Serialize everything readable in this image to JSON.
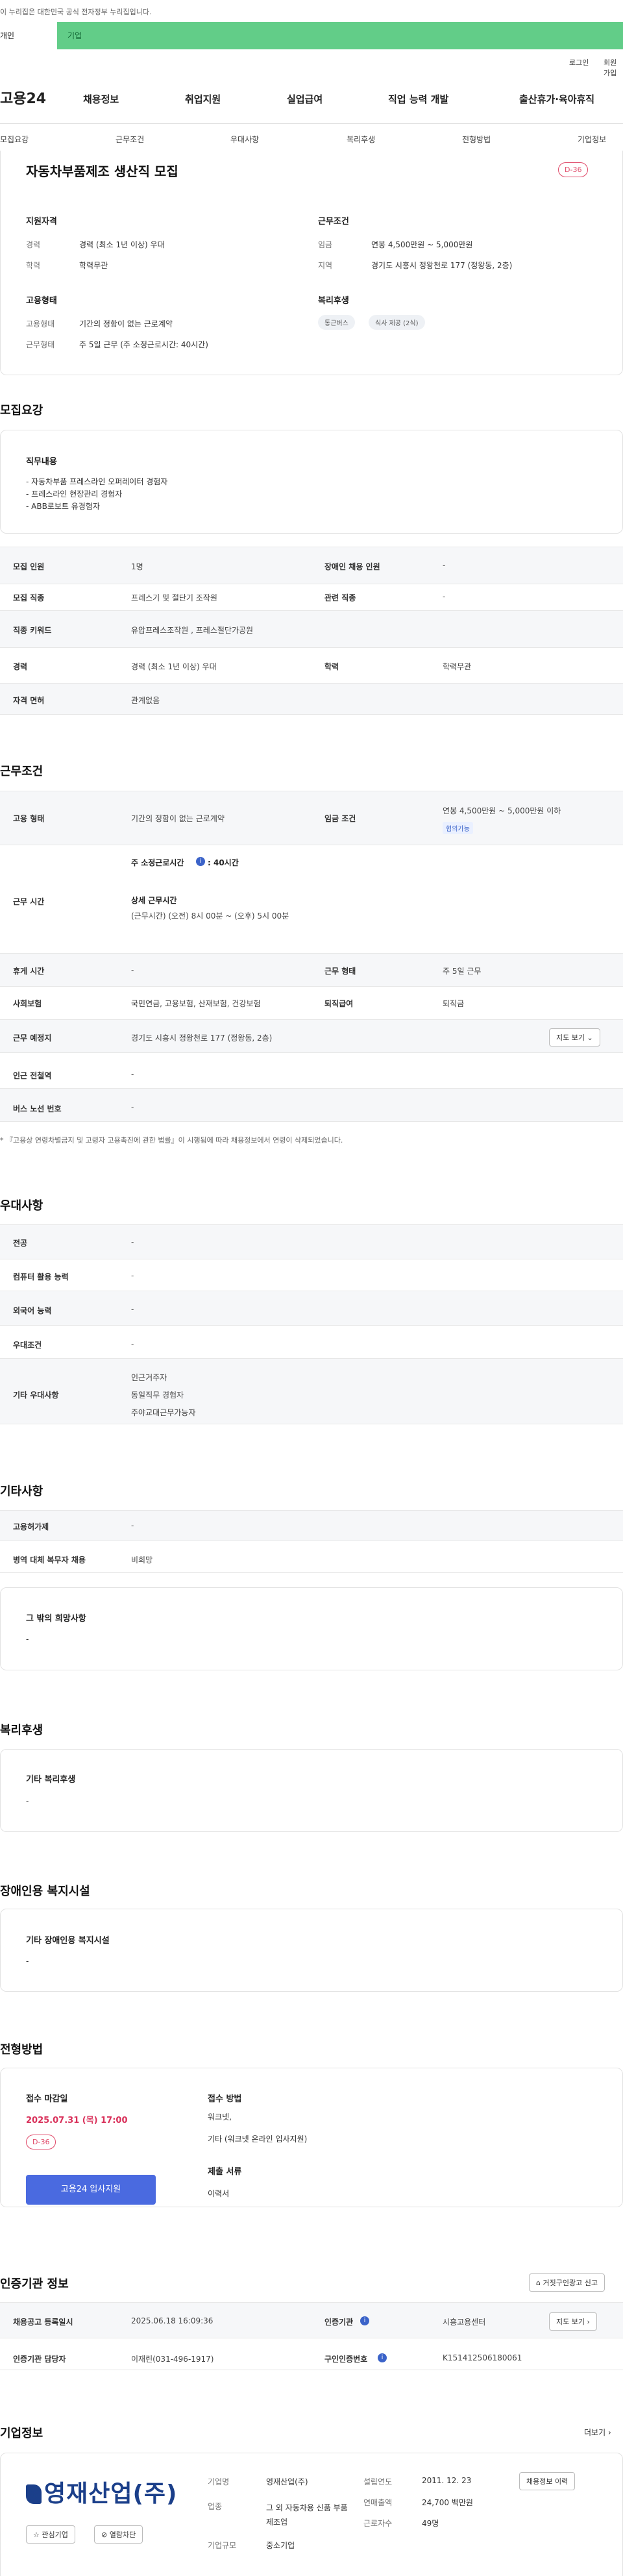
{
  "gov_banner": "이 누리집은 대한민국 공식 전자정부 누리집입니다.",
  "tabs": {
    "individual": "개인",
    "enterprise": "기업"
  },
  "top_links": [
    "로그인",
    "회원가입"
  ],
  "logo_text": "고용24",
  "gnb": [
    "채용정보",
    "취업지원",
    "실업급여",
    "직업 능력 개발",
    "출산휴가·육아휴직"
  ],
  "subnav": [
    "모집요강",
    "근무조건",
    "우대사항",
    "복리후생",
    "전형방법",
    "기업정보"
  ],
  "job": {
    "title": "자동차부품제조 생산직 모집",
    "dday": "D-36",
    "qual_heading": "지원자격",
    "career_label": "경력",
    "career_value": "경력 (최소 1년 이상) 우대",
    "edu_label": "학력",
    "edu_value": "학력무관",
    "emp_heading": "고용형태",
    "emp_label": "고용형태",
    "emp_value": "기간의 정함이 없는 근로계약",
    "work_label": "근무형태",
    "work_value": "주 5일 근무 (주 소정근로시간: 40시간)",
    "cond_heading": "근무조건",
    "wage_label": "임금",
    "wage_value": "연봉 4,500만원 ~ 5,000만원",
    "region_label": "지역",
    "region_value": "경기도 시흥시 정왕천로 177 (정왕동, 2층)",
    "welfare_heading": "복리후생",
    "chips": [
      "통근버스",
      "식사 제공 (2식)"
    ]
  },
  "recruit": {
    "heading": "모집요강",
    "duty_heading": "직무내용",
    "duties": [
      "- 자동차부품 프레스라인 오퍼레이터 경험자",
      "- 프레스라인 현장관리 경험자",
      "- ABB로보트 유경험자"
    ],
    "rows": [
      [
        "모집 인원",
        "1명",
        "장애인 채용 인원",
        "-"
      ],
      [
        "모집 직종",
        "프레스기 및 절단기 조작원",
        "관련 직종",
        "-"
      ],
      [
        "직종 키워드",
        "유압프레스조작원 , 프레스절단가공원",
        "",
        ""
      ],
      [
        "경력",
        "경력 (최소 1년 이상) 우대",
        "학력",
        "학력무관"
      ],
      [
        "자격 면허",
        "관계없음",
        "",
        ""
      ]
    ]
  },
  "conditions": {
    "heading": "근무조건",
    "emp_type_label": "고용 형태",
    "emp_type_value": "기간의 정함이 없는 근로계약",
    "wage_label": "임금 조건",
    "wage_value": "연봉 4,500만원 ~ 5,000만원 이하",
    "wage_chip": "협의가능",
    "hours_label": "근무 시간",
    "hours_weekly": "주 소정근로시간",
    "hours_weekly_value": ": 40시간",
    "hours_detail_title": "상세 근무시간",
    "hours_detail": "(근무시간) (오전) 8시 00분 ~ (오후) 5시 00분",
    "break_label": "휴게 시간",
    "break_value": "-",
    "worktype_label": "근무 형태",
    "worktype_value": "주 5일 근무",
    "insurance_label": "사회보험",
    "insurance_value": "국민연금, 고용보험, 산재보험, 건강보험",
    "retire_label": "퇴직급여",
    "retire_value": "퇴직금",
    "place_label": "근무 예정지",
    "place_value": "경기도 시흥시 정왕천로 177 (정왕동, 2층)",
    "map_button": "지도 보기",
    "subway_label": "인근 전철역",
    "subway_value": "-",
    "bus_label": "버스 노선 번호",
    "bus_value": "-",
    "note": "* 『고용상 연령차별금지 및 고령자 고용촉진에 관한 법률』이 시행됨에 따라 채용정보에서 연령이 삭제되었습니다."
  },
  "prefer": {
    "heading": "우대사항",
    "major_label": "전공",
    "major_value": "-",
    "pc_label": "컴퓨터 활용 능력",
    "pc_value": "-",
    "lang_label": "외국어 능력",
    "lang_value": "-",
    "cond_label": "우대조건",
    "cond_value": "-",
    "etc_label": "기타 우대사항",
    "etc_values": [
      "인근거주자",
      "동일직무 경험자",
      "주야교대근무가능자"
    ]
  },
  "other": {
    "heading": "기타사항",
    "extra_label": "고용허가제",
    "extra_value": "-",
    "military_label": "병역 대체 복무자 채용",
    "military_value": "비희망",
    "wish_title": "그 밖의 희망사항",
    "wish_value": "-"
  },
  "welfare": {
    "heading": "복리후생",
    "card_title": "기타 복리후생",
    "card_value": "-"
  },
  "disabled": {
    "heading": "장애인용 복지시설",
    "card_title": "기타 장애인용 복지시설",
    "card_value": "-"
  },
  "process": {
    "heading": "전형방법",
    "deadline_title": "접수 마감일",
    "deadline": "2025.07.31 (목) 17:00",
    "dday": "D-36",
    "apply_button": "고용24 입사지원",
    "method_title": "접수 방법",
    "methods": [
      "워크넷,",
      "기타 (워크넷 온라인 입사지원)"
    ],
    "docs_title": "제출 서류",
    "docs": "이력서"
  },
  "cert": {
    "heading": "인증기관 정보",
    "report_button": "거짓구인광고 신고",
    "reg_label": "채용공고 등록일시",
    "reg_value": "2025.06.18 16:09:36",
    "org_label": "인증기관",
    "org_value": "시흥고용센터",
    "map_button": "지도 보기",
    "mgr_label": "인증기관 담당자",
    "mgr_value": "이재린(031-496-1917)",
    "cert_no_label": "구인인증번호",
    "cert_no_value": "K151412506180061"
  },
  "company": {
    "heading": "기업정보",
    "more": "더보기",
    "logo_text": "영재산업(주)",
    "fav_button": "관심기업",
    "block_button": "열람차단",
    "name_label": "기업명",
    "name_value": "영재산업(주)",
    "industry_label": "업종",
    "industry_value": "그 외 자동차용 신품 부품 제조업",
    "scale_label": "기업규모",
    "scale_value": "중소기업",
    "founded_label": "설립연도",
    "founded_value": "2011. 12. 23",
    "sales_label": "연매출액",
    "sales_value": "24,700 백만원",
    "staff_label": "근로자수",
    "staff_value": "49명",
    "hire_history_button": "채용정보 이력"
  }
}
